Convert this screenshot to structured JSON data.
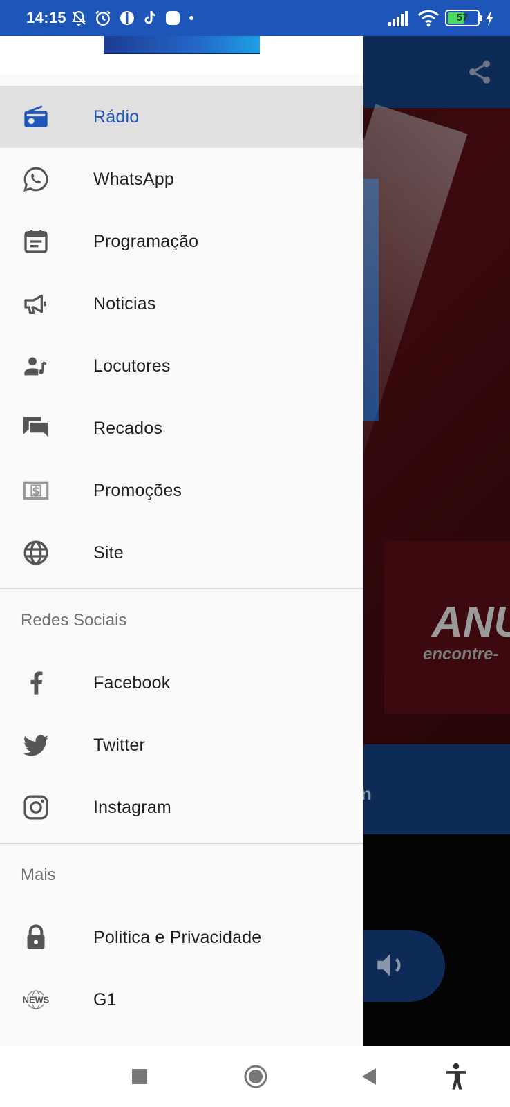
{
  "status_bar": {
    "time": "14:15",
    "battery_level": "57",
    "icons": [
      "mute-bell-icon",
      "alarm-icon",
      "app-icon",
      "tiktok-icon",
      "app-square-icon",
      "dot-icon",
      "signal-icon",
      "wifi-icon",
      "battery-icon",
      "charging-icon"
    ]
  },
  "background_app": {
    "ad_title": "ANU",
    "ad_subtitle": "encontre-",
    "bar_text": "n"
  },
  "drawer": {
    "menu": [
      {
        "label": "Rádio",
        "icon": "radio-icon",
        "active": true
      },
      {
        "label": "WhatsApp",
        "icon": "whatsapp-icon",
        "active": false
      },
      {
        "label": "Programação",
        "icon": "schedule-icon",
        "active": false
      },
      {
        "label": "Noticias",
        "icon": "megaphone-icon",
        "active": false
      },
      {
        "label": "Locutores",
        "icon": "announcer-icon",
        "active": false
      },
      {
        "label": "Recados",
        "icon": "messages-icon",
        "active": false
      },
      {
        "label": "Promoções",
        "icon": "dollar-bill-icon",
        "active": false
      },
      {
        "label": "Site",
        "icon": "globe-icon",
        "active": false
      }
    ],
    "social_section_title": "Redes Sociais",
    "social": [
      {
        "label": "Facebook",
        "icon": "facebook-icon"
      },
      {
        "label": "Twitter",
        "icon": "twitter-icon"
      },
      {
        "label": "Instagram",
        "icon": "instagram-icon"
      }
    ],
    "more_section_title": "Mais",
    "more": [
      {
        "label": "Politica e Privacidade",
        "icon": "lock-icon"
      },
      {
        "label": "G1",
        "icon": "news-globe-icon",
        "icon_text": "NEWS"
      }
    ]
  },
  "nav_bar": {
    "buttons": [
      "recents-button",
      "home-button",
      "back-button",
      "accessibility-button"
    ]
  },
  "colors": {
    "accent": "#1d56b8",
    "status_bar": "#1d56b8",
    "active_item_bg": "#e0e0e0",
    "drawer_bg": "#f9f9f9"
  }
}
